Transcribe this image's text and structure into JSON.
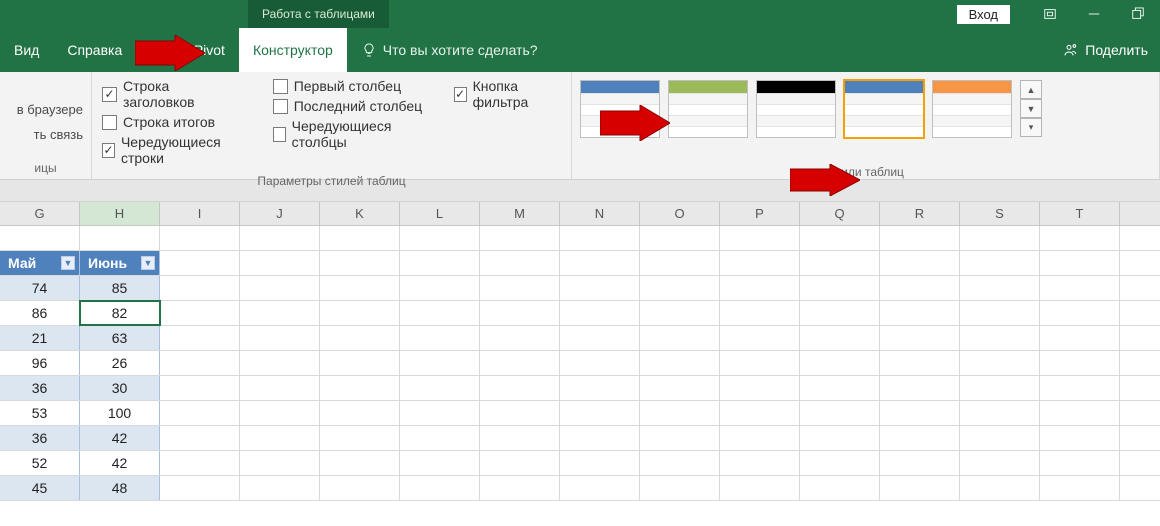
{
  "title_context": "Работа с таблицами",
  "login": "Вход",
  "tabs": {
    "view": "Вид",
    "help": "Справка",
    "powerpivot": "Power Pivot",
    "design": "Конструктор"
  },
  "tellme": "Что вы хотите сделать?",
  "share": "Поделить",
  "left_stub": {
    "browser": "в браузере",
    "link": "ть связь",
    "group": "ицы"
  },
  "options": {
    "header_row": "Строка заголовков",
    "total_row": "Строка итогов",
    "banded_rows": "Чередующиеся строки",
    "first_col": "Первый столбец",
    "last_col": "Последний столбец",
    "banded_cols": "Чередующиеся столбцы",
    "filter_btn": "Кнопка фильтра",
    "group_label": "Параметры стилей таблиц"
  },
  "styles_label": "Стили таблиц",
  "col_headers": [
    "G",
    "H",
    "I",
    "J",
    "K",
    "L",
    "M",
    "N",
    "O",
    "P",
    "Q",
    "R",
    "S",
    "T"
  ],
  "table": {
    "headers": [
      "Май",
      "Июнь"
    ],
    "rows": [
      [
        74,
        85
      ],
      [
        86,
        82
      ],
      [
        21,
        63
      ],
      [
        96,
        26
      ],
      [
        36,
        30
      ],
      [
        53,
        100
      ],
      [
        36,
        42
      ],
      [
        52,
        42
      ],
      [
        45,
        48
      ]
    ]
  },
  "chart_data": {
    "type": "table",
    "title": "",
    "columns": [
      "Май",
      "Июнь"
    ],
    "rows": [
      [
        74,
        85
      ],
      [
        86,
        82
      ],
      [
        21,
        63
      ],
      [
        96,
        26
      ],
      [
        36,
        30
      ],
      [
        53,
        100
      ],
      [
        36,
        42
      ],
      [
        52,
        42
      ],
      [
        45,
        48
      ]
    ]
  },
  "style_colors": [
    "#4f81bd",
    "#9bbb59",
    "#000000",
    "#4f81bd",
    "#f79646"
  ]
}
